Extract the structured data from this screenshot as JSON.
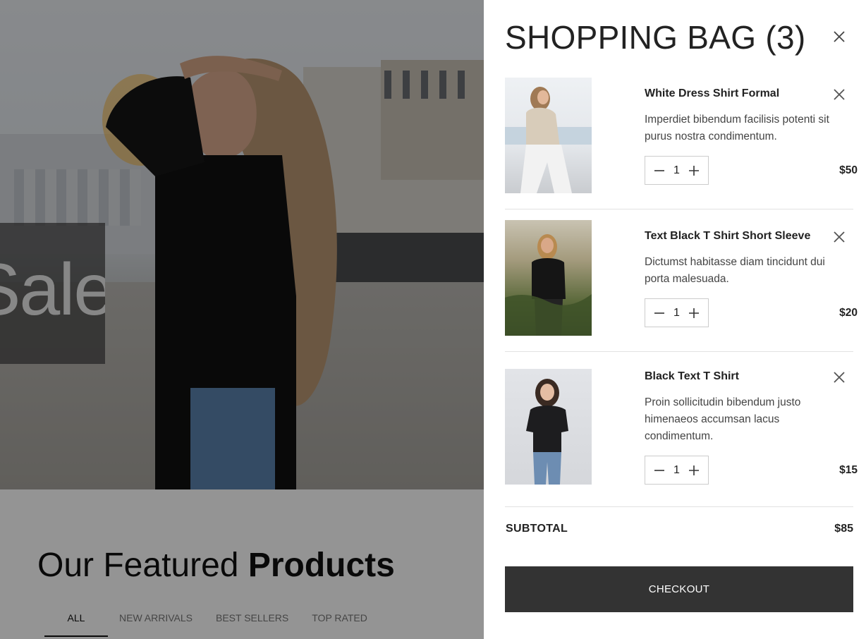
{
  "hero": {
    "sale_text": "Sale"
  },
  "featured": {
    "title_light": "Our Featured ",
    "title_bold": "Products"
  },
  "filter_tabs": [
    {
      "label": "ALL",
      "active": true
    },
    {
      "label": "NEW ARRIVALS",
      "active": false
    },
    {
      "label": "BEST SELLERS",
      "active": false
    },
    {
      "label": "TOP RATED",
      "active": false
    }
  ],
  "cart": {
    "title": "SHOPPING BAG (3)",
    "items": [
      {
        "name": "White Dress Shirt Formal",
        "description": "Imperdiet bibendum facilisis potenti sit purus nostra condimentum.",
        "quantity": "1",
        "price": "$50"
      },
      {
        "name": "Text Black T Shirt Short Sleeve",
        "description": "Dictumst habitasse diam tincidunt dui porta malesuada.",
        "quantity": "1",
        "price": "$20"
      },
      {
        "name": "Black Text T Shirt",
        "description": "Proin sollicitudin bibendum justo himenaeos accumsan lacus condimentum.",
        "quantity": "1",
        "price": "$15"
      }
    ],
    "subtotal_label": "SUBTOTAL",
    "subtotal_value": "$85",
    "checkout_label": "CHECKOUT"
  },
  "icons": {
    "close": "close-icon",
    "minus": "minus-icon",
    "plus": "plus-icon"
  },
  "colors": {
    "checkout_bg": "#333333",
    "overlay": "rgba(0,0,0,0.42)"
  }
}
